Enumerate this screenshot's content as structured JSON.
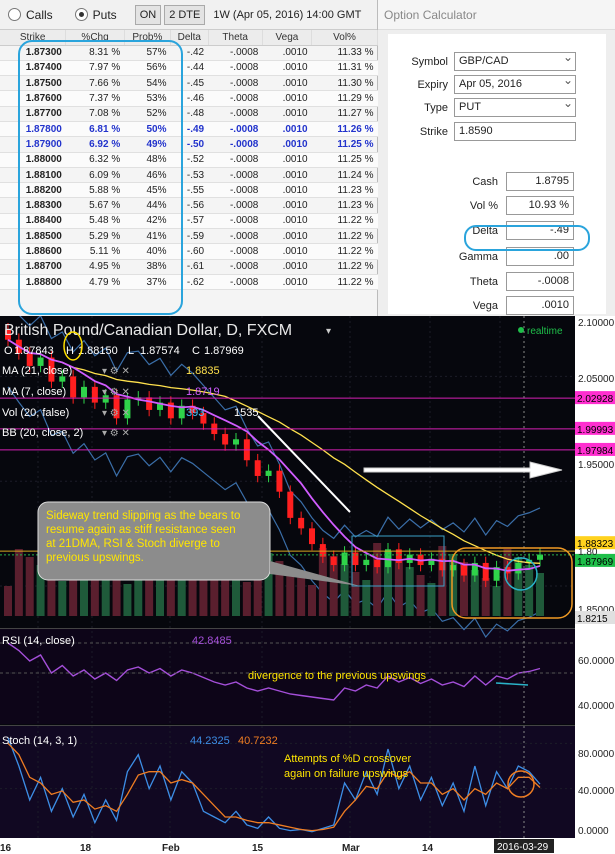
{
  "toolbar": {
    "calls_label": "Calls",
    "puts_label": "Puts",
    "on_label": "ON",
    "dte_label": "2 DTE",
    "expiry_label": "1W (Apr 05, 2016) 14:00 GMT"
  },
  "chain": {
    "headers": [
      "Strike",
      "%Chg",
      "Prob%",
      "Delta",
      "Theta",
      "Vega",
      "Vol%"
    ],
    "rows": [
      [
        "1.87300",
        "8.31 %",
        "57%",
        "-.42",
        "-.0008",
        ".0010",
        "11.33 %"
      ],
      [
        "1.87400",
        "7.97 %",
        "56%",
        "-.44",
        "-.0008",
        ".0010",
        "11.31 %"
      ],
      [
        "1.87500",
        "7.66 %",
        "54%",
        "-.45",
        "-.0008",
        ".0010",
        "11.30 %"
      ],
      [
        "1.87600",
        "7.37 %",
        "53%",
        "-.46",
        "-.0008",
        ".0010",
        "11.29 %"
      ],
      [
        "1.87700",
        "7.08 %",
        "52%",
        "-.48",
        "-.0008",
        ".0010",
        "11.27 %"
      ],
      [
        "1.87800",
        "6.81 %",
        "50%",
        "-.49",
        "-.0008",
        ".0010",
        "11.26 %"
      ],
      [
        "1.87900",
        "6.92 %",
        "49%",
        "-.50",
        "-.0008",
        ".0010",
        "11.25 %"
      ],
      [
        "1.88000",
        "6.32 %",
        "48%",
        "-.52",
        "-.0008",
        ".0010",
        "11.25 %"
      ],
      [
        "1.88100",
        "6.09 %",
        "46%",
        "-.53",
        "-.0008",
        ".0010",
        "11.24 %"
      ],
      [
        "1.88200",
        "5.88 %",
        "45%",
        "-.55",
        "-.0008",
        ".0010",
        "11.23 %"
      ],
      [
        "1.88300",
        "5.67 %",
        "44%",
        "-.56",
        "-.0008",
        ".0010",
        "11.23 %"
      ],
      [
        "1.88400",
        "5.48 %",
        "42%",
        "-.57",
        "-.0008",
        ".0010",
        "11.22 %"
      ],
      [
        "1.88500",
        "5.29 %",
        "41%",
        "-.59",
        "-.0008",
        ".0010",
        "11.22 %"
      ],
      [
        "1.88600",
        "5.11 %",
        "40%",
        "-.60",
        "-.0008",
        ".0010",
        "11.22 %"
      ],
      [
        "1.88700",
        "4.95 %",
        "38%",
        "-.61",
        "-.0008",
        ".0010",
        "11.22 %"
      ],
      [
        "1.88800",
        "4.79 %",
        "37%",
        "-.62",
        "-.0008",
        ".0010",
        "11.22 %"
      ]
    ],
    "highlight_rows": [
      5,
      6
    ]
  },
  "calc": {
    "title": "Option Calculator",
    "symbol_label": "Symbol",
    "symbol": "GBP/CAD",
    "expiry_label": "Expiry",
    "expiry": "Apr 05, 2016",
    "type_label": "Type",
    "type": "PUT",
    "strike_label": "Strike",
    "strike": "1.8590",
    "cash_label": "Cash",
    "cash": "1.8795",
    "vol_label": "Vol %",
    "vol": "10.93 %",
    "delta_label": "Delta",
    "delta": "-.49",
    "gamma_label": "Gamma",
    "gamma": ".00",
    "theta_label": "Theta",
    "theta": "-.0008",
    "vega_label": "Vega",
    "vega": ".0010"
  },
  "chart": {
    "title": "British Pound/Canadian Dollar, D, FXCM",
    "realtime_label": "realtime",
    "ohlc": {
      "o_label": "O",
      "o": "1.87843",
      "h_label": "H",
      "h": "1.88150",
      "l_label": "L",
      "l": "1.87574",
      "c_label": "C",
      "c": "1.87969"
    },
    "indicators": [
      {
        "label": "MA (21, close)",
        "value": "1.8835",
        "color": "#ffe14d"
      },
      {
        "label": "MA (7, close)",
        "value": "1.8719",
        "color": "#d15cff"
      },
      {
        "label": "Vol (20, false)",
        "value": "393",
        "value2": "1535",
        "color": "#47c6ff"
      },
      {
        "label": "BB (20, close, 2)",
        "value": "",
        "color": "#4a90c8"
      }
    ],
    "price_ticks": [
      "2.10000",
      "2.05000",
      "1.95000",
      "1.85000"
    ],
    "price_tags": [
      {
        "text": "2.02928",
        "bg": "#ff2fd0"
      },
      {
        "text": "1.99993",
        "bg": "#ff2fd0"
      },
      {
        "text": "1.97984",
        "bg": "#ff2fd0"
      },
      {
        "text": "1.88323",
        "bg": "#ffd21e"
      },
      {
        "text": "1.87969",
        "bg": "#1fbf4a"
      },
      {
        "text": "1.8215",
        "bg": "#e0e0e0"
      }
    ],
    "price_tag_partial": "1.80",
    "annotation": "Sideway trend slipping as the bears to resume again as stiff resistance seen at 21DMA, RSI & Stoch diverge to previous upswings.",
    "rsi": {
      "label": "RSI (14, close)",
      "value": "42.8485",
      "note": "divergence to the previous upswings",
      "ticks": [
        "60.0000",
        "40.0000"
      ]
    },
    "stoch": {
      "label": "Stoch (14, 3, 1)",
      "k": "44.2325",
      "d": "40.7232",
      "note_line1": "Attempts of %D crossover",
      "note_line2": "again on failure upswings",
      "ticks": [
        "80.0000",
        "40.0000",
        "0.0000"
      ]
    },
    "xaxis": [
      "16",
      "18",
      "Feb",
      "15",
      "Mar",
      "14"
    ],
    "xaxis_current": "2016-03-29"
  },
  "chart_data": {
    "type": "candlestick",
    "title": "British Pound/Canadian Dollar, D, FXCM",
    "ylim": [
      1.8,
      2.1
    ],
    "close_series": [
      2.085,
      2.072,
      2.06,
      2.068,
      2.045,
      2.05,
      2.03,
      2.04,
      2.025,
      2.032,
      2.01,
      2.028,
      2.03,
      2.018,
      2.025,
      2.01,
      2.022,
      2.015,
      2.005,
      1.995,
      1.985,
      1.99,
      1.97,
      1.955,
      1.96,
      1.94,
      1.915,
      1.905,
      1.89,
      1.878,
      1.87,
      1.882,
      1.87,
      1.875,
      1.868,
      1.885,
      1.872,
      1.88,
      1.87,
      1.876,
      1.865,
      1.87,
      1.86,
      1.872,
      1.855,
      1.868,
      1.862,
      1.872,
      1.875,
      1.88
    ],
    "rsi_series": [
      60,
      55,
      48,
      52,
      40,
      45,
      38,
      42,
      36,
      40,
      35,
      42,
      44,
      40,
      43,
      38,
      42,
      40,
      37,
      34,
      32,
      34,
      30,
      28,
      30,
      28,
      26,
      25,
      24,
      23,
      22,
      30,
      28,
      32,
      30,
      38,
      34,
      37,
      33,
      36,
      32,
      34,
      31,
      38,
      32,
      38,
      36,
      40,
      41,
      43
    ],
    "stoch_k": [
      85,
      60,
      30,
      50,
      20,
      40,
      15,
      35,
      10,
      30,
      12,
      55,
      70,
      40,
      60,
      30,
      55,
      45,
      20,
      15,
      10,
      20,
      8,
      5,
      15,
      5,
      3,
      4,
      2,
      5,
      8,
      45,
      30,
      55,
      35,
      75,
      40,
      60,
      30,
      50,
      25,
      45,
      20,
      60,
      25,
      55,
      40,
      60,
      55,
      44
    ],
    "stoch_d": [
      80,
      70,
      50,
      45,
      35,
      38,
      28,
      30,
      22,
      25,
      20,
      35,
      52,
      55,
      55,
      45,
      48,
      45,
      35,
      25,
      15,
      15,
      12,
      10,
      10,
      8,
      6,
      4,
      3,
      4,
      6,
      20,
      30,
      42,
      40,
      55,
      50,
      55,
      45,
      45,
      35,
      40,
      30,
      40,
      35,
      45,
      40,
      50,
      50,
      41
    ]
  }
}
